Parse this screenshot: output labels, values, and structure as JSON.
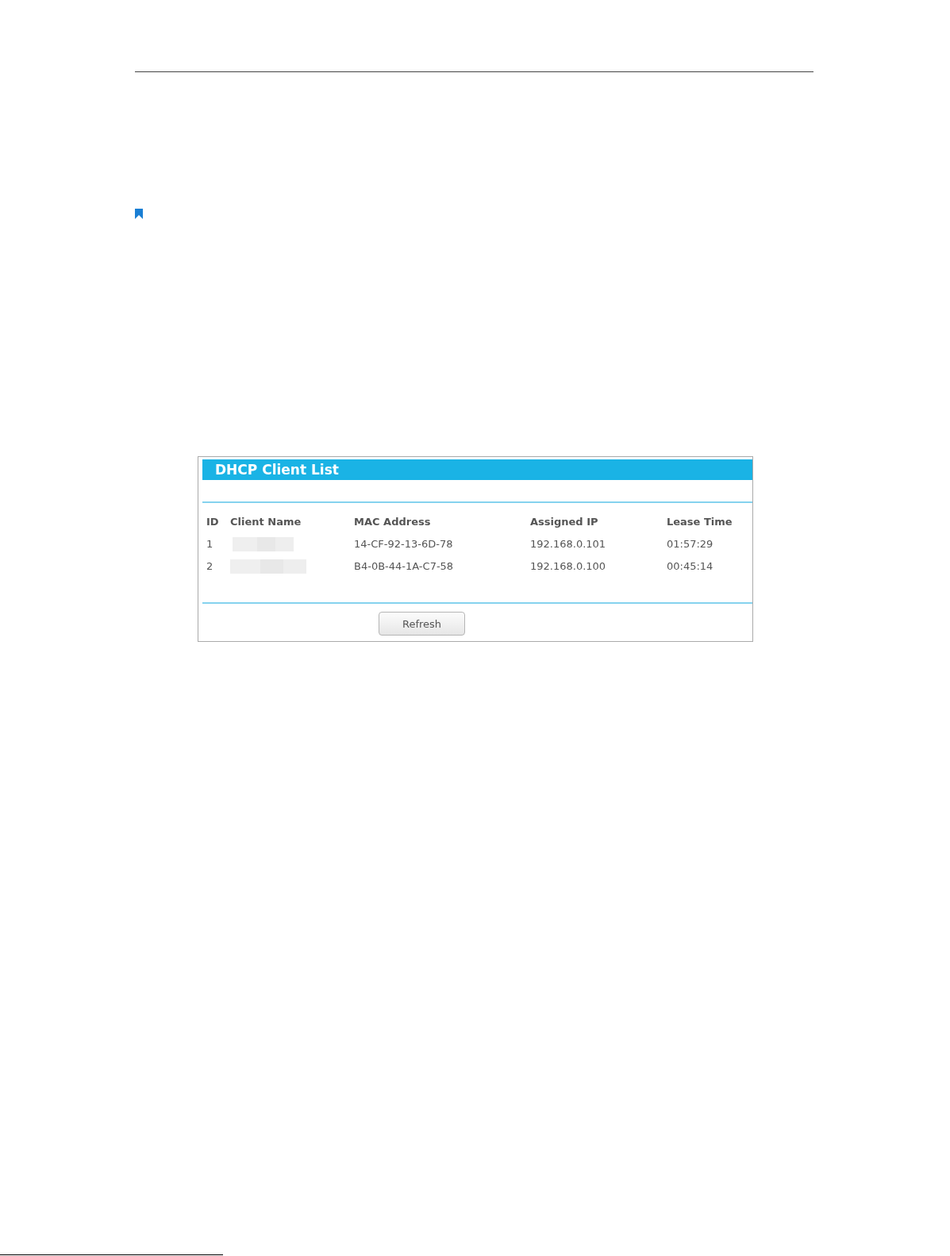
{
  "panel": {
    "title": "DHCP Client List",
    "columns": [
      "ID",
      "Client Name",
      "MAC Address",
      "Assigned IP",
      "Lease Time"
    ],
    "rows": [
      {
        "id": "1",
        "name_blurred": true,
        "mac": "14-CF-92-13-6D-78",
        "ip": "192.168.0.101",
        "lease": "01:57:29"
      },
      {
        "id": "2",
        "name_blurred": true,
        "mac": "B4-0B-44-1A-C7-58",
        "ip": "192.168.0.100",
        "lease": "00:45:14"
      }
    ],
    "button": "Refresh"
  }
}
